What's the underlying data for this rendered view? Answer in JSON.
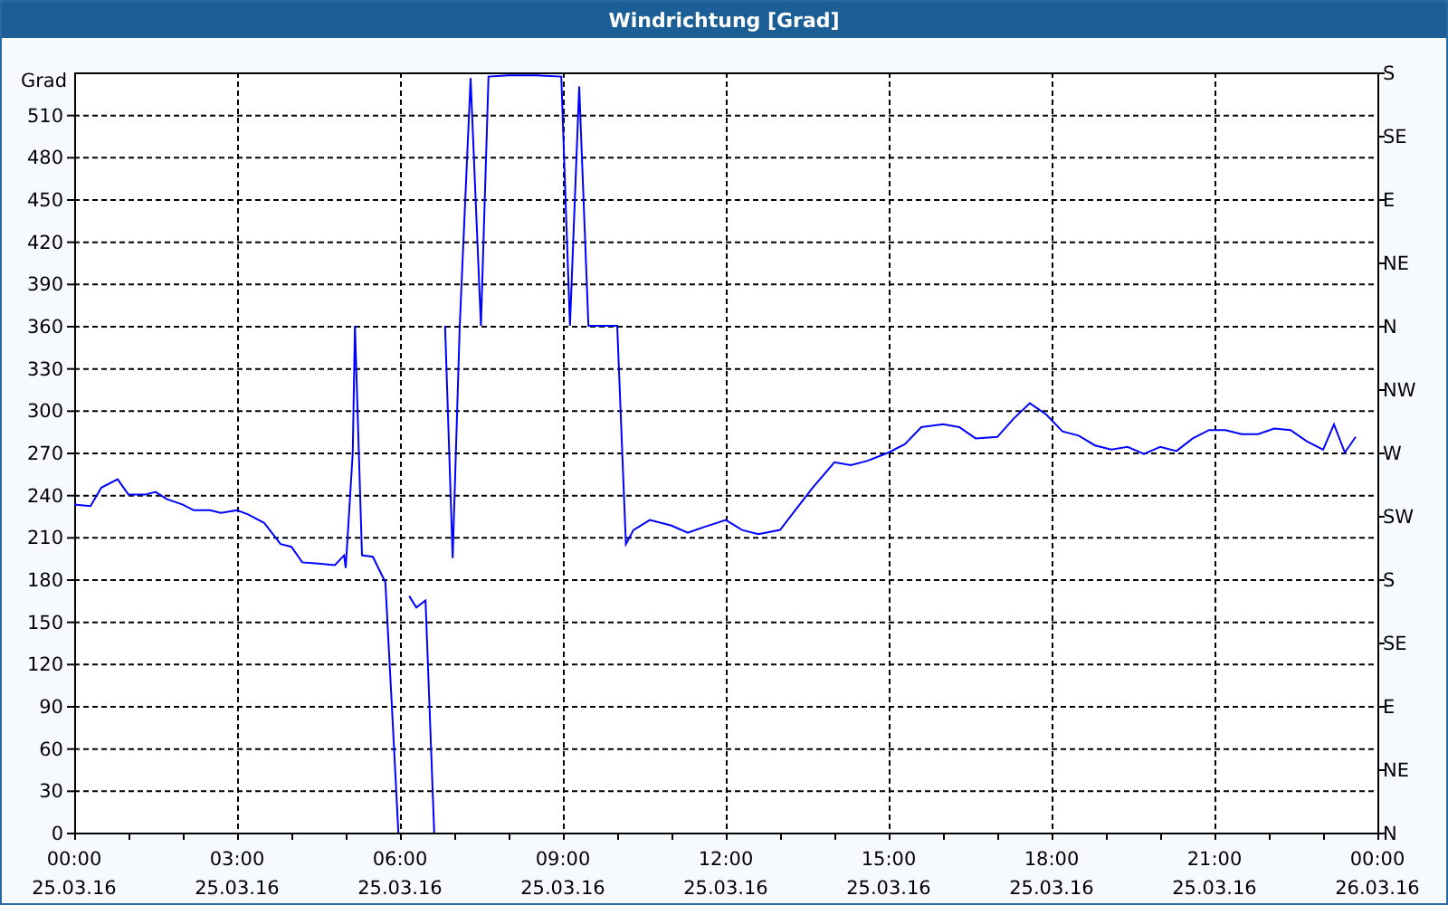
{
  "window": {
    "title": "Windrichtung [Grad]"
  },
  "chart": {
    "chart_data": {
      "type": "line",
      "ylabel": "Grad",
      "grid": true,
      "xlim": [
        0,
        24
      ],
      "ylim": [
        0,
        540
      ],
      "xticks": [
        {
          "value": 0,
          "label": "00:00"
        },
        {
          "value": 3,
          "label": "03:00"
        },
        {
          "value": 6,
          "label": "06:00"
        },
        {
          "value": 9,
          "label": "09:00"
        },
        {
          "value": 12,
          "label": "12:00"
        },
        {
          "value": 15,
          "label": "15:00"
        },
        {
          "value": 18,
          "label": "18:00"
        },
        {
          "value": 21,
          "label": "21:00"
        },
        {
          "value": 24,
          "label": "00:00"
        }
      ],
      "yticks": [
        0,
        30,
        60,
        90,
        120,
        150,
        180,
        210,
        240,
        270,
        300,
        330,
        360,
        390,
        420,
        450,
        480,
        510
      ],
      "x": [
        0,
        0.3,
        0.5,
        0.8,
        1.0,
        1.3,
        1.5,
        1.7,
        2.0,
        2.2,
        2.5,
        2.7,
        3.0,
        3.2,
        3.5,
        3.8,
        4.0,
        4.2,
        4.5,
        4.8,
        4.97,
        5.0,
        5.13,
        5.17,
        5.3,
        5.5,
        5.73,
        5.85,
        5.97,
        null,
        6.17,
        6.3,
        6.47,
        6.63,
        null,
        6.83,
        6.97,
        7.1,
        7.3,
        7.49,
        7.63,
        8.0,
        8.5,
        8.97,
        9.13,
        9.3,
        9.47,
        10.0,
        10.16,
        10.3,
        10.6,
        11.0,
        11.3,
        11.6,
        12.0,
        12.3,
        12.6,
        13.0,
        13.3,
        13.6,
        14.0,
        14.3,
        14.6,
        15.0,
        15.3,
        15.6,
        16.0,
        16.3,
        16.6,
        17.0,
        17.3,
        17.6,
        17.9,
        18.2,
        18.5,
        18.8,
        19.1,
        19.4,
        19.7,
        20.0,
        20.3,
        20.6,
        20.9,
        21.2,
        21.5,
        21.8,
        22.1,
        22.4,
        22.7,
        23.0,
        23.2,
        23.4,
        23.6
      ],
      "series": [
        {
          "color": "#0000ff",
          "values": [
            233,
            232,
            245,
            251,
            240,
            240,
            242,
            237,
            233,
            229,
            229,
            227,
            229,
            226,
            220,
            205,
            203,
            192,
            191,
            190,
            197,
            188,
            270,
            360,
            197,
            196,
            178,
            90,
            0,
            null,
            168,
            160,
            165,
            0,
            null,
            360,
            195,
            360,
            536,
            360,
            537,
            538,
            538,
            537,
            360,
            530,
            360,
            360,
            205,
            215,
            222,
            218,
            213,
            217,
            222,
            215,
            212,
            215,
            230,
            245,
            263,
            261,
            264,
            270,
            276,
            288,
            290,
            288,
            280,
            281,
            294,
            305,
            297,
            285,
            282,
            275,
            272,
            274,
            269,
            274,
            271,
            280,
            286,
            286,
            283,
            283,
            287,
            286,
            278,
            272,
            290,
            270,
            281
          ]
        }
      ]
    },
    "x_dates": [
      "25.03.16",
      "25.03.16",
      "25.03.16",
      "25.03.16",
      "25.03.16",
      "25.03.16",
      "25.03.16",
      "25.03.16",
      "26.03.16"
    ],
    "right_axis_labels": [
      "S",
      "SE",
      "E",
      "NE",
      "N",
      "NW",
      "W",
      "SW",
      "S",
      "SE",
      "E",
      "NE",
      "N"
    ]
  }
}
